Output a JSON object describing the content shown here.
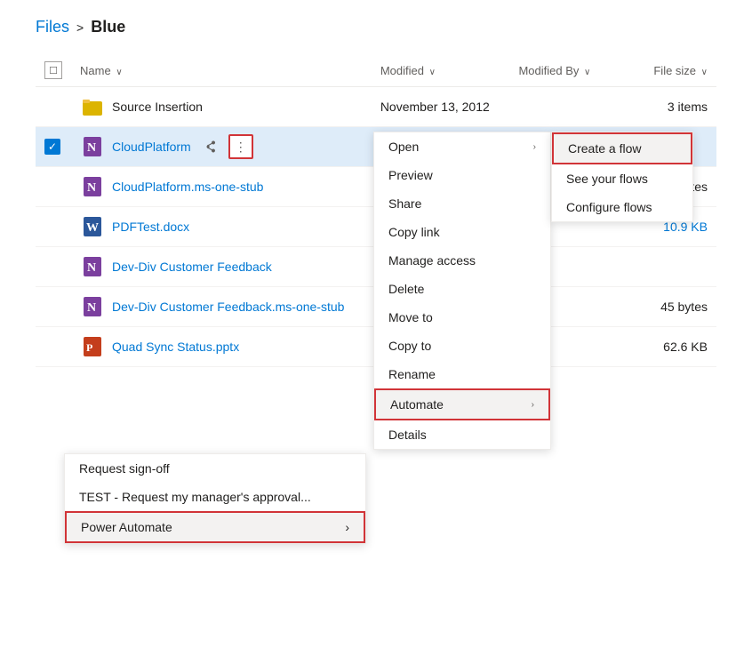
{
  "breadcrumb": {
    "root": "Files",
    "separator": ">",
    "current": "Blue"
  },
  "table": {
    "headers": {
      "name": "Name",
      "modified": "Modified",
      "modified_by": "Modified By",
      "file_size": "File size"
    },
    "rows": [
      {
        "id": "row-source-insertion",
        "icon": "folder",
        "name": "Source Insertion",
        "modified": "November 13, 2012",
        "modified_by": "",
        "file_size": "3 items",
        "selected": false
      },
      {
        "id": "row-cloudplatform",
        "icon": "onenote",
        "name": "CloudPlatform",
        "modified": "",
        "modified_by": "",
        "file_size": "",
        "selected": true
      },
      {
        "id": "row-cloudplatform-stub",
        "icon": "onenote",
        "name": "CloudPlatform.ms-one-stub",
        "modified": "",
        "modified_by": "",
        "file_size": "45 bytes",
        "selected": false
      },
      {
        "id": "row-pdftest",
        "icon": "word",
        "name": "PDFTest.docx",
        "modified": "",
        "modified_by": "",
        "file_size": "10.9 KB",
        "selected": false
      },
      {
        "id": "row-devdiv-feedback",
        "icon": "onenote",
        "name": "Dev-Div Customer Feedback",
        "modified": "",
        "modified_by": "",
        "file_size": "",
        "selected": false
      },
      {
        "id": "row-devdiv-feedback-stub",
        "icon": "onenote",
        "name": "Dev-Div Customer Feedback.ms-one-stub",
        "modified": "",
        "modified_by": "",
        "file_size": "45 bytes",
        "selected": false
      },
      {
        "id": "row-quadsync",
        "icon": "ppt",
        "name": "Quad Sync Status.pptx",
        "modified": "",
        "modified_by": "",
        "file_size": "62.6 KB",
        "selected": false
      }
    ]
  },
  "context_menu_primary": {
    "items": [
      {
        "label": "Open",
        "has_submenu": true
      },
      {
        "label": "Preview",
        "has_submenu": false
      },
      {
        "label": "Share",
        "has_submenu": false
      },
      {
        "label": "Copy link",
        "has_submenu": false
      },
      {
        "label": "Manage access",
        "has_submenu": false
      },
      {
        "label": "Delete",
        "has_submenu": false
      },
      {
        "label": "Move to",
        "has_submenu": false
      },
      {
        "label": "Copy to",
        "has_submenu": false
      },
      {
        "label": "Rename",
        "has_submenu": false
      },
      {
        "label": "Automate",
        "has_submenu": true,
        "highlighted": true
      },
      {
        "label": "Details",
        "has_submenu": false
      }
    ]
  },
  "context_menu_secondary": {
    "items": [
      {
        "label": "Create a flow",
        "highlighted": true
      },
      {
        "label": "See your flows"
      },
      {
        "label": "Configure flows"
      }
    ]
  },
  "left_context_menu": {
    "items": [
      {
        "label": "Request sign-off",
        "has_submenu": false
      },
      {
        "label": "TEST - Request my manager's approval...",
        "has_submenu": false
      },
      {
        "label": "Power Automate",
        "has_submenu": true,
        "highlighted": true
      }
    ]
  }
}
